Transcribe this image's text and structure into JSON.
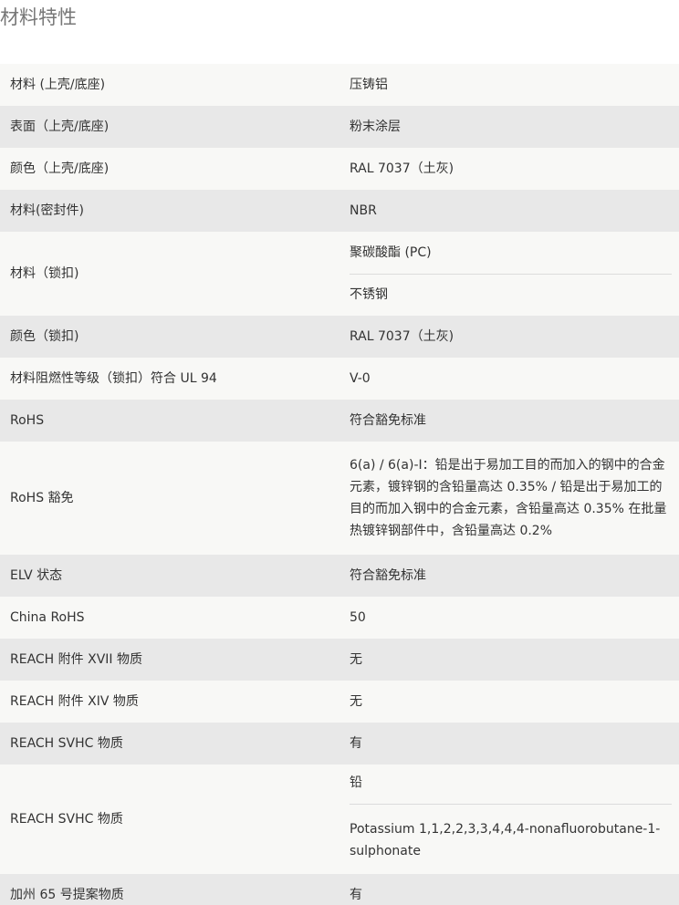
{
  "section": {
    "title": "材料特性"
  },
  "rows": [
    {
      "label": "材料 (上壳/底座)",
      "values": [
        "压铸铝"
      ]
    },
    {
      "label": "表面（上壳/底座)",
      "values": [
        "粉末涂层"
      ]
    },
    {
      "label": "颜色（上壳/底座)",
      "values": [
        "RAL 7037（土灰)"
      ]
    },
    {
      "label": "材料(密封件)",
      "values": [
        "NBR"
      ]
    },
    {
      "label": "材料（锁扣)",
      "values": [
        "聚碳酸酯 (PC)",
        "不锈钢"
      ]
    },
    {
      "label": "颜色（锁扣)",
      "values": [
        "RAL 7037（土灰)"
      ]
    },
    {
      "label": "材料阻燃性等级（锁扣）符合 UL 94",
      "values": [
        "V-0"
      ]
    },
    {
      "label": "RoHS",
      "values": [
        "符合豁免标准"
      ]
    },
    {
      "label": "RoHS 豁免",
      "values": [
        "6(a) / 6(a)-I：铅是出于易加工目的而加入的钢中的合金元素，镀锌钢的含铅量高达 0.35% / 铅是出于易加工的目的而加入钢中的合金元素，含铅量高达 0.35% 在批量热镀锌钢部件中，含铅量高达 0.2%"
      ]
    },
    {
      "label": "ELV 状态",
      "values": [
        "符合豁免标准"
      ]
    },
    {
      "label": "China RoHS",
      "values": [
        "50"
      ]
    },
    {
      "label": "REACH 附件 XVII 物质",
      "values": [
        "无"
      ]
    },
    {
      "label": "REACH 附件 XIV 物质",
      "values": [
        "无"
      ]
    },
    {
      "label": "REACH SVHC 物质",
      "values": [
        "有"
      ]
    },
    {
      "label": "REACH SVHC 物质",
      "values": [
        "铅",
        "Potassium 1,1,2,2,3,3,4,4,4-nonafluorobutane-1-sulphonate"
      ]
    },
    {
      "label": "加州 65 号提案物质",
      "values": [
        "有"
      ]
    }
  ]
}
